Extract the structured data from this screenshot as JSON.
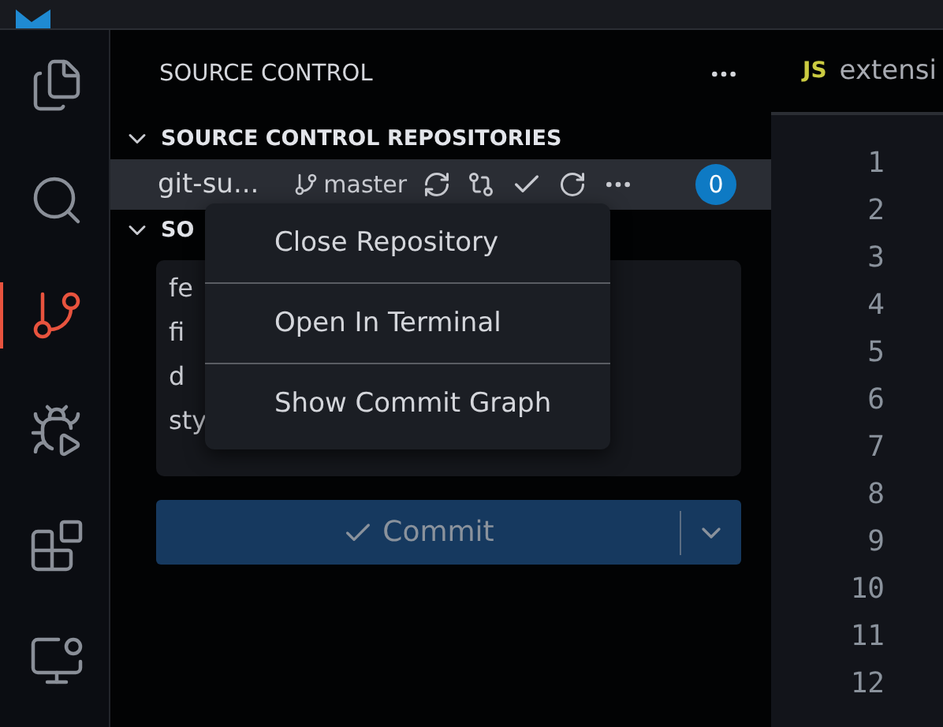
{
  "activity_bar": [
    {
      "kind": "files",
      "selected": false
    },
    {
      "kind": "search",
      "selected": false
    },
    {
      "kind": "source_control",
      "selected": true
    },
    {
      "kind": "run",
      "selected": false
    },
    {
      "kind": "extensions",
      "selected": false
    },
    {
      "kind": "remote",
      "selected": false
    }
  ],
  "sidebar": {
    "title": "SOURCE CONTROL",
    "repositories": {
      "header": "SOURCE CONTROL REPOSITORIES",
      "expanded": true,
      "repos": [
        {
          "name": "git-su...",
          "branch": "master",
          "count": "0",
          "selected": true
        }
      ]
    },
    "changes_section": {
      "header": "SO",
      "expanded": true
    },
    "message_lines": [
      "fe",
      "fi",
      "d",
      "sty"
    ],
    "commit_button": {
      "label": "Commit",
      "disabled": true
    }
  },
  "context_menu": {
    "items": [
      "Close Repository",
      "Open In Terminal",
      "Show Commit Graph"
    ]
  },
  "editor": {
    "tab": {
      "icon": "JS",
      "label": "extensi"
    },
    "line_numbers": [
      "1",
      "2",
      "3",
      "4",
      "5",
      "6",
      "7",
      "8",
      "9",
      "10",
      "11",
      "12"
    ]
  }
}
